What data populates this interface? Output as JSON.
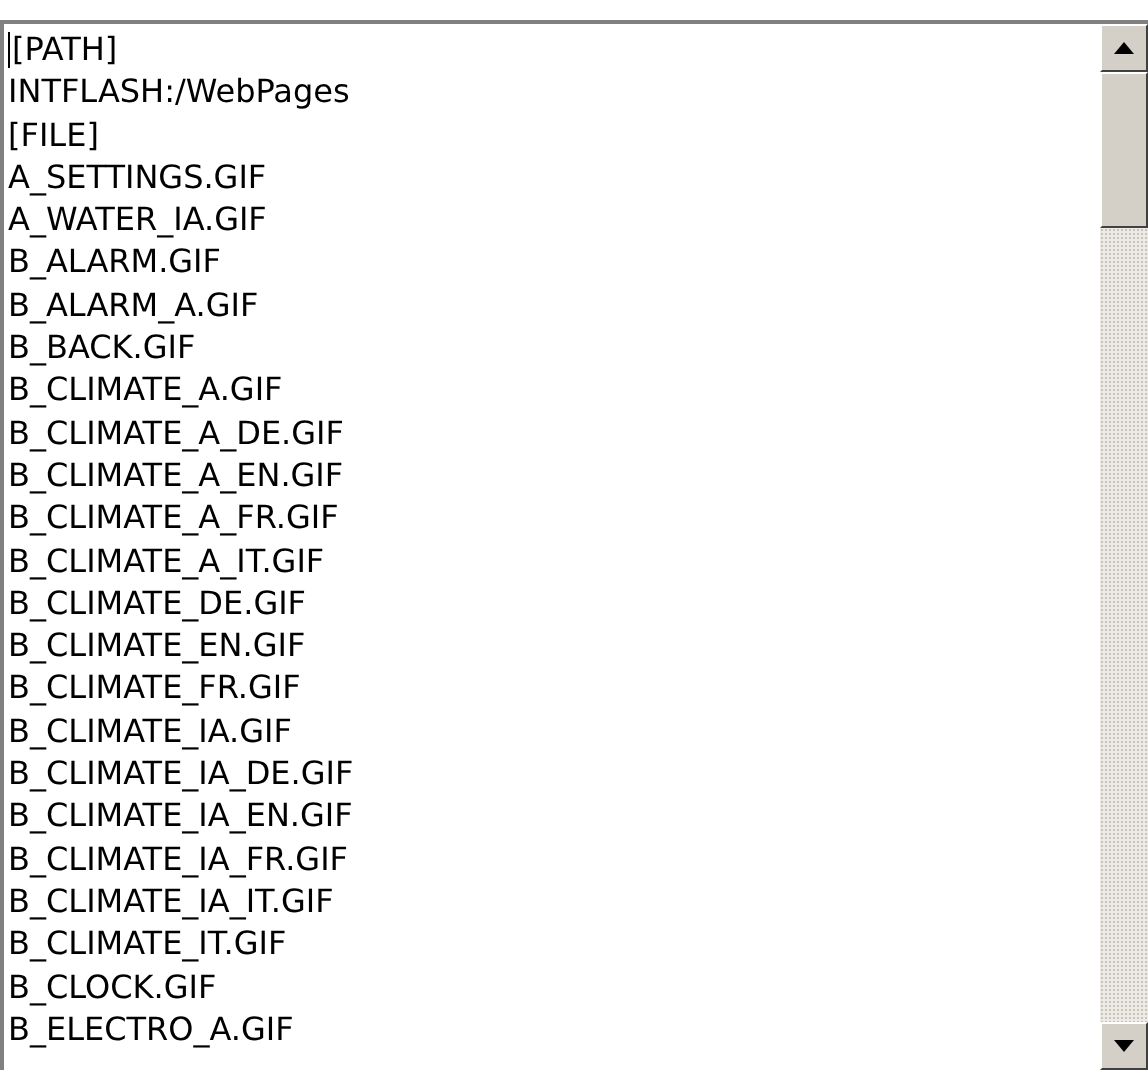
{
  "text_area": {
    "lines": [
      "[PATH]",
      "INTFLASH:/WebPages",
      "[FILE]",
      "A_SETTINGS.GIF",
      "A_WATER_IA.GIF",
      "B_ALARM.GIF",
      "B_ALARM_A.GIF",
      "B_BACK.GIF",
      "B_CLIMATE_A.GIF",
      "B_CLIMATE_A_DE.GIF",
      "B_CLIMATE_A_EN.GIF",
      "B_CLIMATE_A_FR.GIF",
      "B_CLIMATE_A_IT.GIF",
      "B_CLIMATE_DE.GIF",
      "B_CLIMATE_EN.GIF",
      "B_CLIMATE_FR.GIF",
      "B_CLIMATE_IA.GIF",
      "B_CLIMATE_IA_DE.GIF",
      "B_CLIMATE_IA_EN.GIF",
      "B_CLIMATE_IA_FR.GIF",
      "B_CLIMATE_IA_IT.GIF",
      "B_CLIMATE_IT.GIF",
      "B_CLOCK.GIF",
      "B_ELECTRO_A.GIF"
    ]
  }
}
